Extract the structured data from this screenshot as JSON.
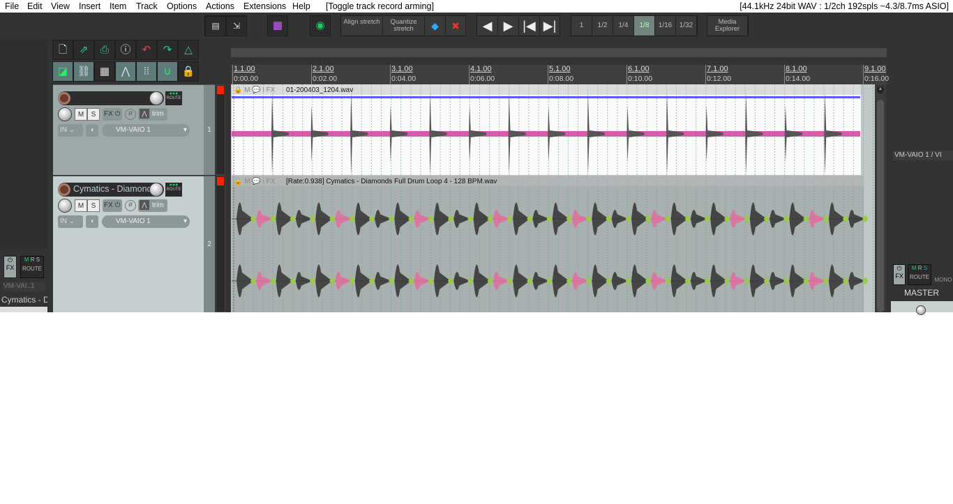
{
  "menu": {
    "items": [
      "File",
      "Edit",
      "View",
      "Insert",
      "Item",
      "Track",
      "Options",
      "Actions",
      "Extensions",
      "Help"
    ],
    "action_hint": "[Toggle track record arming]",
    "status": "[44.1kHz 24bit WAV : 1/2ch 192spls ~4.3/8.7ms ASIO]"
  },
  "toolbar": {
    "align_stretch": "Align stretch",
    "quantize_stretch": "Quantize stretch",
    "grid_divisions": [
      "1",
      "1/2",
      "1/4",
      "1/8",
      "1/16",
      "1/32"
    ],
    "grid_selected": "1/8",
    "media_explorer": "Media Explorer"
  },
  "ruler": {
    "measures": [
      "1.1.00",
      "2.1.00",
      "3.1.00",
      "4.1.00",
      "5.1.00",
      "6.1.00",
      "7.1.00",
      "8.1.00",
      "9.1.00"
    ],
    "times": [
      "0:00.00",
      "0:02.00",
      "0:04.00",
      "0:06.00",
      "0:08.00",
      "0:10.00",
      "0:12.00",
      "0:14.00",
      "0:16.00"
    ]
  },
  "tracks": [
    {
      "number": "1",
      "name": "",
      "input": "IN",
      "output": "VM-VAIO 1",
      "trim": "trim",
      "mute": "M",
      "solo": "S",
      "fx": "FX",
      "route": "ROUTE",
      "item": "01-200403_1204.wav"
    },
    {
      "number": "2",
      "name": "Cymatics - Diamonc",
      "input": "IN",
      "output": "VM-VAIO 1",
      "trim": "trim",
      "mute": "M",
      "solo": "S",
      "fx": "FX",
      "route": "ROUTE",
      "item": "[Rate:0.938] Cymatics - Diamonds Full Drum Loop 4 - 128 BPM.wav"
    }
  ],
  "item_header_labels": {
    "mute": "M",
    "info": "i",
    "fx": "FX"
  },
  "mixer": {
    "left_output": "VM-VAI..1",
    "left_track": "Cymatics - D",
    "fx": "FX",
    "route": "ROUTE",
    "mrs": [
      "M",
      "R",
      "S"
    ],
    "right_output": "VM-VAIO 1 / VI",
    "mono": "MONO",
    "master": "MASTER"
  },
  "colors": {
    "accent_grid": "#7aa3a0",
    "waveform_pink": "#d040a0",
    "item_top_bar": "#5a5aff",
    "record_arm": "#ff2000"
  }
}
